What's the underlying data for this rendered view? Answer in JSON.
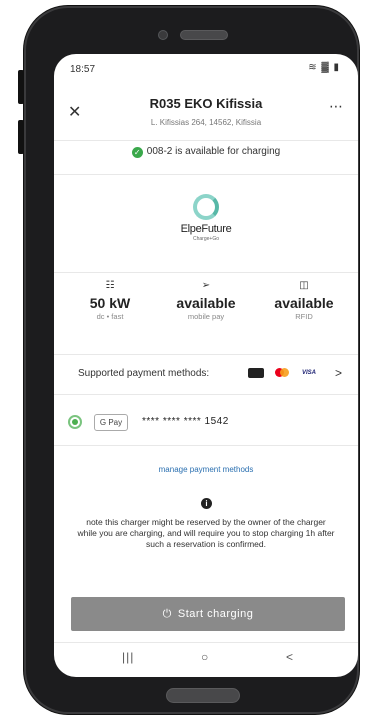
{
  "status_bar": {
    "time": "18:57",
    "icons": "≋ ▓ ▮"
  },
  "header": {
    "close_glyph": "✕",
    "title": "R035 EKO Kifissia",
    "address": "L. Kifissias  264, 14562, Kifissia",
    "more_glyph": "⋯"
  },
  "availability": {
    "text": "008-2 is available for charging",
    "color": "#3aa84b"
  },
  "operator": {
    "brand": "ElpeFuture",
    "tagline": "Charge+Go",
    "accent": "#8cd4c9"
  },
  "stats": [
    {
      "icon": "plug-icon",
      "value": "50 kW",
      "sub": "dc • fast"
    },
    {
      "icon": "mobile-pay-icon",
      "value": "available",
      "sub": "mobile pay"
    },
    {
      "icon": "rfid-icon",
      "value": "available",
      "sub": "RFID"
    }
  ],
  "payment": {
    "label": "Supported payment methods:",
    "cards": [
      "card-icon",
      "mastercard-icon",
      "visa-icon"
    ],
    "visa_label": "VISA",
    "chevron": ">"
  },
  "selected_method": {
    "brand": "G Pay",
    "number": "**** **** **** 1542"
  },
  "manage_link": "manage payment methods",
  "note": "note this charger might be reserved by the owner of the charger while you are charging, and will require you to stop charging 1h after such a reservation is confirmed.",
  "start_button": {
    "label": "Start charging",
    "color": "#8a8a8a"
  },
  "nav": {
    "recents": "|||",
    "home": "○",
    "back": "<"
  }
}
